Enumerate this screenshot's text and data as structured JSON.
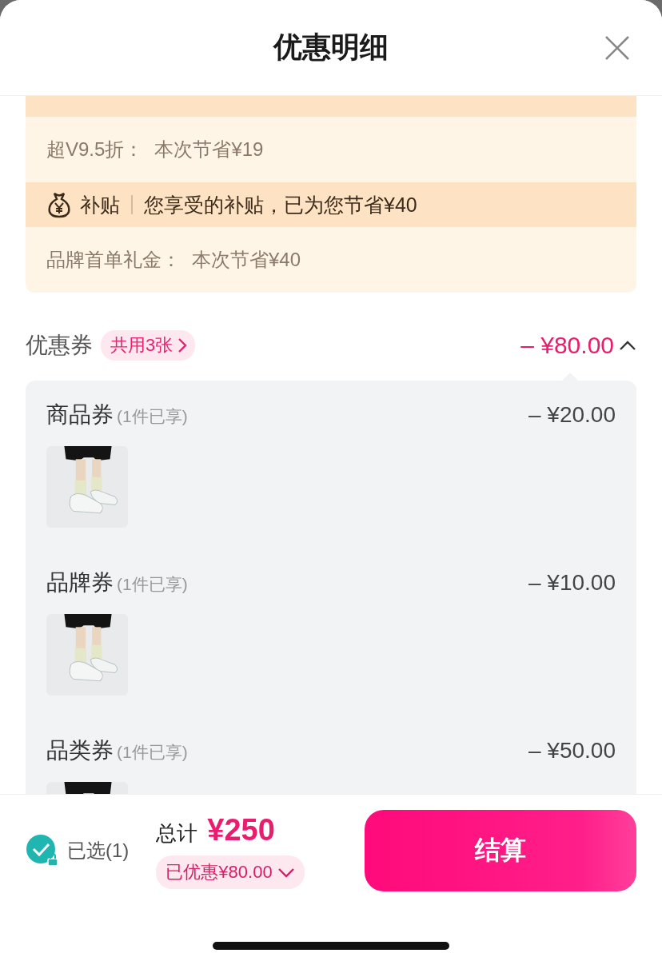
{
  "title": "优惠明细",
  "benefits": [
    {
      "kind": "vip",
      "details": [
        {
          "label": "超V9.5折：",
          "value": "本次节省¥19"
        }
      ]
    },
    {
      "kind": "subsidy",
      "tag": "补贴",
      "summary": "您享受的补贴，已为您节省¥40",
      "details": [
        {
          "label": "品牌首单礼金：",
          "value": "本次节省¥40"
        }
      ]
    }
  ],
  "coupons": {
    "label": "优惠券",
    "count_badge": "共用3张",
    "total": "– ¥80.00",
    "expanded": true,
    "items": [
      {
        "name": "商品券",
        "note": "(1件已享)",
        "amount": "– ¥20.00"
      },
      {
        "name": "品牌券",
        "note": "(1件已享)",
        "amount": "– ¥10.00"
      },
      {
        "name": "品类券",
        "note": "(1件已享)",
        "amount": "– ¥50.00"
      }
    ]
  },
  "footer": {
    "selected_label": "已选(1)",
    "checked": true,
    "total_label": "总计",
    "total": "¥250",
    "discount": "已优惠¥80.00",
    "checkout": "结算"
  }
}
